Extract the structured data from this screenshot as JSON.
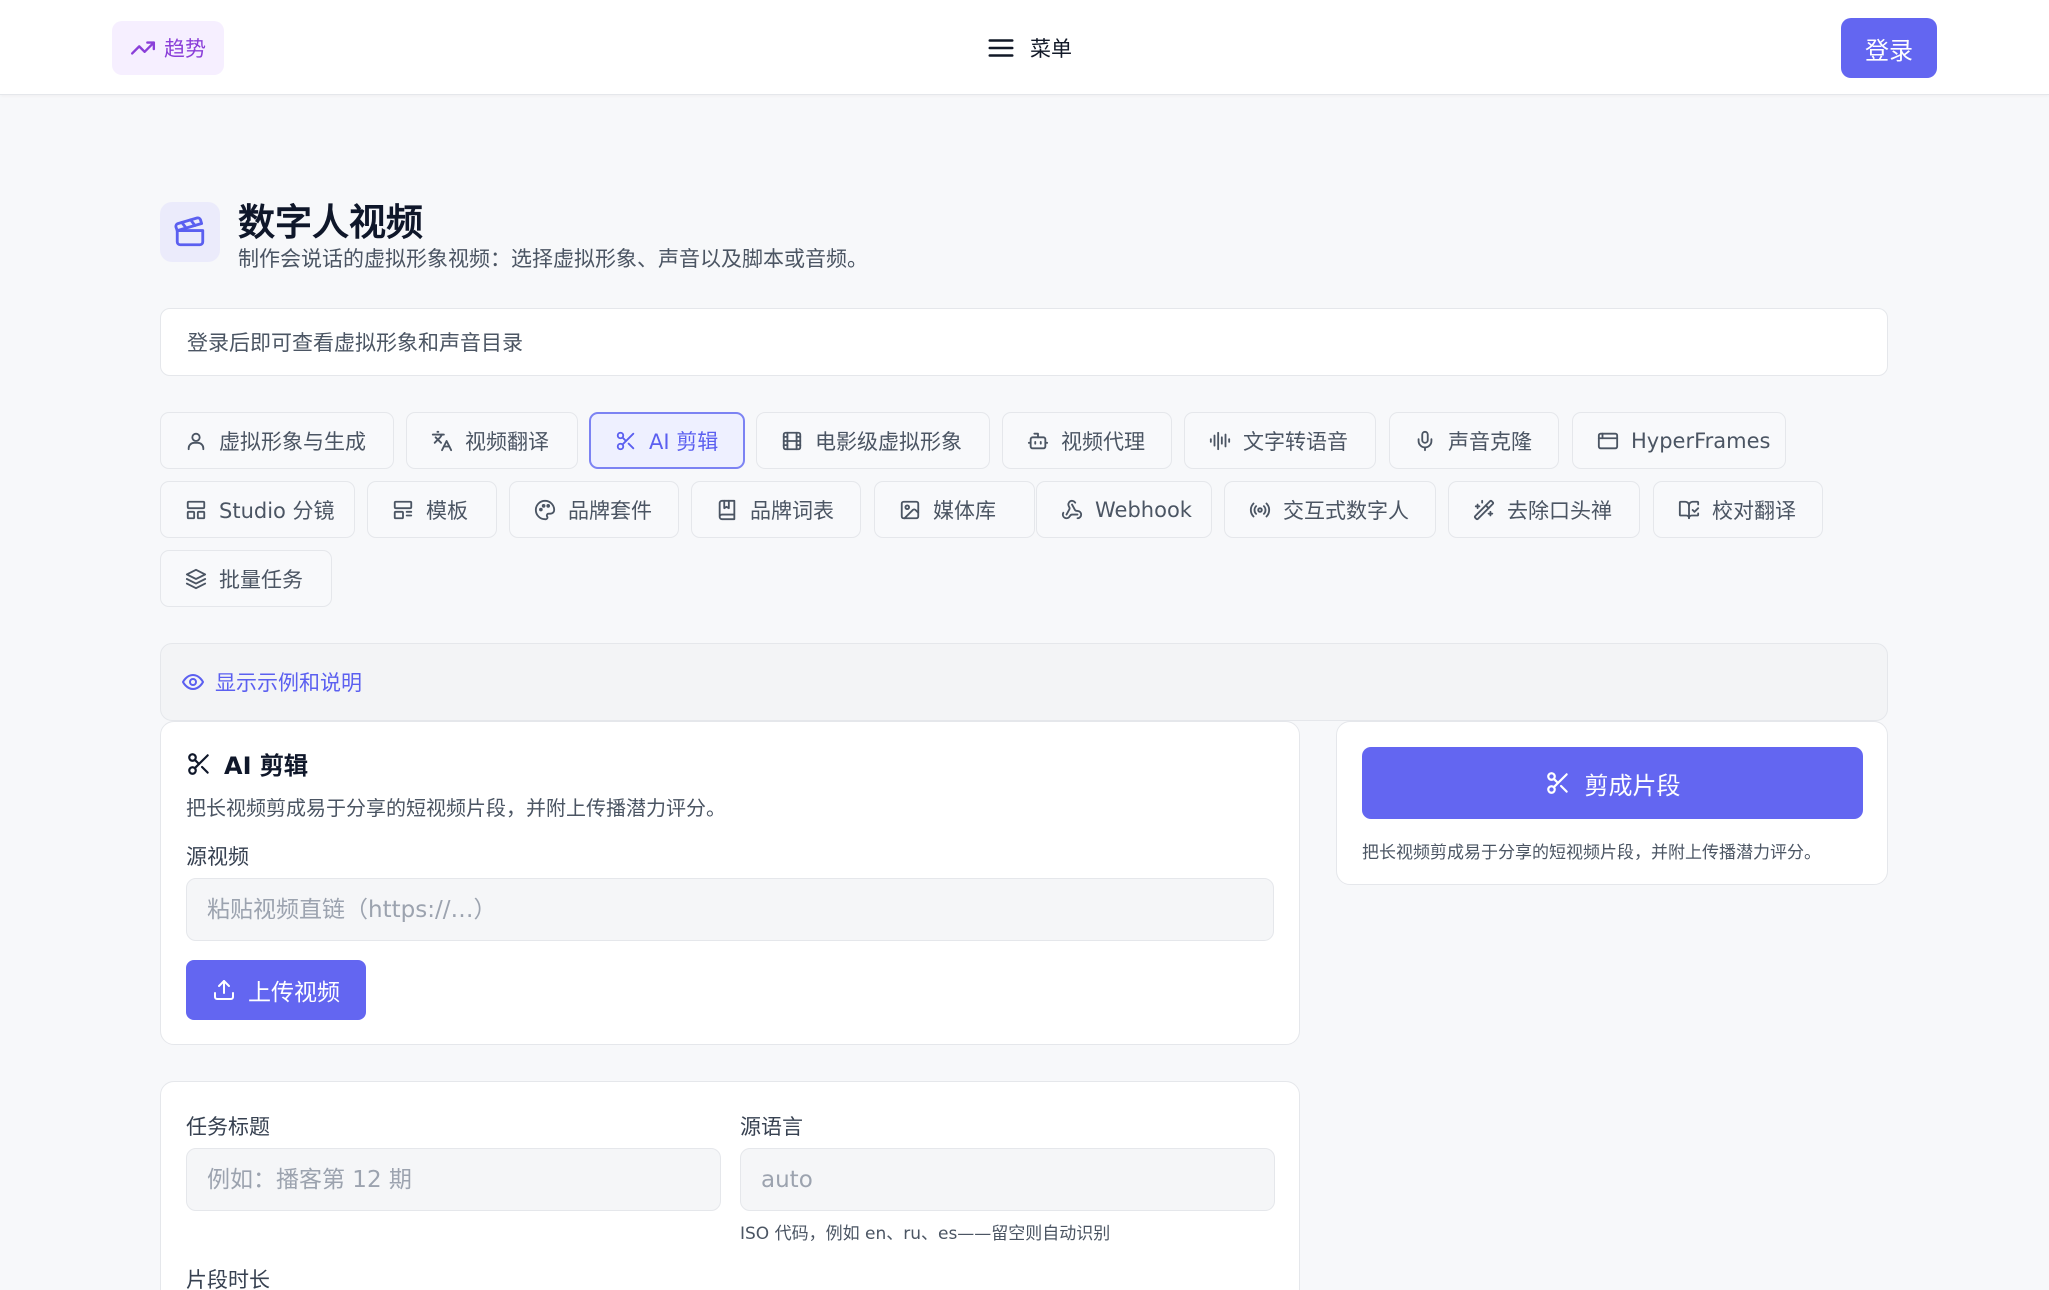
{
  "header": {
    "trend_label": "趋势",
    "menu_label": "菜单",
    "login_label": "登录"
  },
  "page": {
    "title": "数字人视频",
    "subtitle": "制作会说话的虚拟形象视频：选择虚拟形象、声音以及脚本或音频。",
    "notice": "登录后即可查看虚拟形象和声音目录"
  },
  "tabs": [
    {
      "label": "虚拟形象与生成",
      "icon": "user-icon"
    },
    {
      "label": "视频翻译",
      "icon": "translate-icon"
    },
    {
      "label": "AI 剪辑",
      "icon": "scissors-icon",
      "active": true
    },
    {
      "label": "电影级虚拟形象",
      "icon": "film-icon"
    },
    {
      "label": "视频代理",
      "icon": "robot-icon"
    },
    {
      "label": "文字转语音",
      "icon": "audio-lines-icon"
    },
    {
      "label": "声音克隆",
      "icon": "microphone-icon"
    },
    {
      "label": "HyperFrames",
      "icon": "browser-window-icon"
    },
    {
      "label": "Studio 分镜",
      "icon": "layout-icon"
    },
    {
      "label": "模板",
      "icon": "template-icon"
    },
    {
      "label": "品牌套件",
      "icon": "palette-icon"
    },
    {
      "label": "品牌词表",
      "icon": "book-icon"
    },
    {
      "label": "媒体库",
      "icon": "image-icon"
    },
    {
      "label": "Webhook",
      "icon": "webhook-icon"
    },
    {
      "label": "交互式数字人",
      "icon": "radio-icon"
    },
    {
      "label": "去除口头禅",
      "icon": "magic-wand-icon"
    },
    {
      "label": "校对翻译",
      "icon": "book-check-icon"
    },
    {
      "label": "批量任务",
      "icon": "layers-icon"
    }
  ],
  "examples_toggle": "显示示例和说明",
  "clip": {
    "title": "AI 剪辑",
    "description": "把长视频剪成易于分享的短视频片段，并附上传播潜力评分。",
    "source_label": "源视频",
    "source_placeholder": "粘贴视频直链（https://…）",
    "upload_label": "上传视频"
  },
  "action": {
    "button_label": "剪成片段",
    "description": "把长视频剪成易于分享的短视频片段，并附上传播潜力评分。"
  },
  "settings": {
    "task_title_label": "任务标题",
    "task_title_placeholder": "例如：播客第 12 期",
    "source_lang_label": "源语言",
    "source_lang_placeholder": "auto",
    "source_lang_hint": "ISO 代码，例如 en、ru、es——留空则自动识别",
    "clip_length_label": "片段时长"
  },
  "colors": {
    "accent": "#6366f1",
    "trend": "#8b3fd9",
    "background": "#f7f8fa"
  }
}
